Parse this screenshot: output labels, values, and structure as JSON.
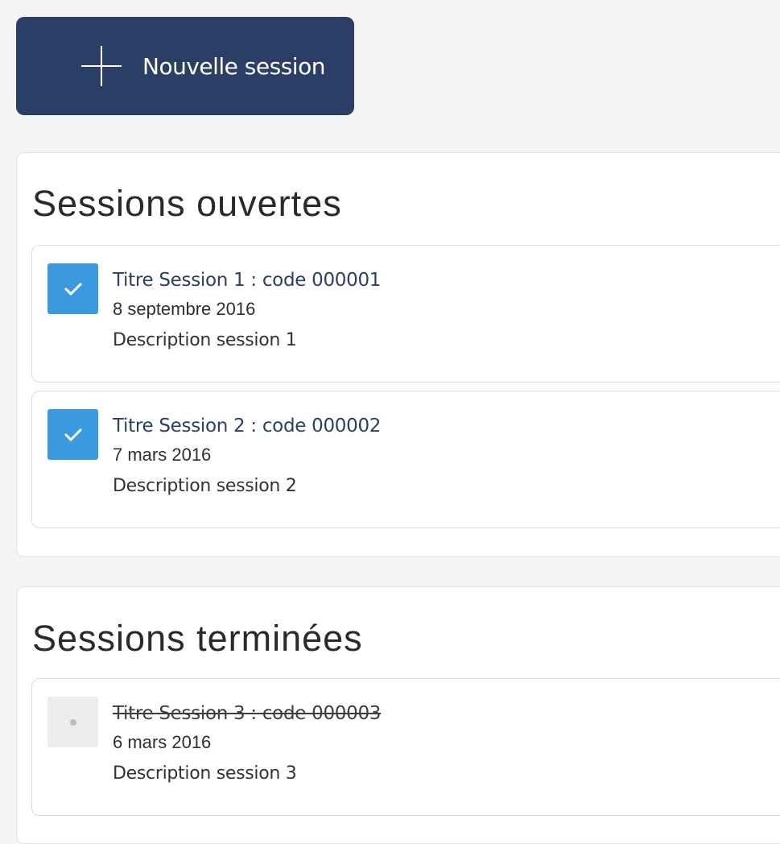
{
  "toolbar": {
    "new_session_label": "Nouvelle session"
  },
  "open_sessions": {
    "title": "Sessions ouvertes",
    "items": [
      {
        "title": "Titre Session 1 : code 000001",
        "date": "8 septembre 2016",
        "description": "Description session 1",
        "checked": true
      },
      {
        "title": "Titre Session 2 : code 000002",
        "date": "7 mars 2016",
        "description": "Description session 2",
        "checked": true
      }
    ]
  },
  "finished_sessions": {
    "title": "Sessions terminées",
    "items": [
      {
        "title": "Titre Session 3 : code 000003",
        "date": "6 mars 2016",
        "description": "Description session 3",
        "checked": false
      }
    ]
  },
  "colors": {
    "primary_button": "#2b3e66",
    "checkbox_checked": "#3b99dd",
    "checkbox_unchecked": "#ececec",
    "title_text": "#2b3e66"
  },
  "icons": {
    "new_session": "plus-icon",
    "checked": "checkmark-icon",
    "unchecked": "dot-icon"
  }
}
